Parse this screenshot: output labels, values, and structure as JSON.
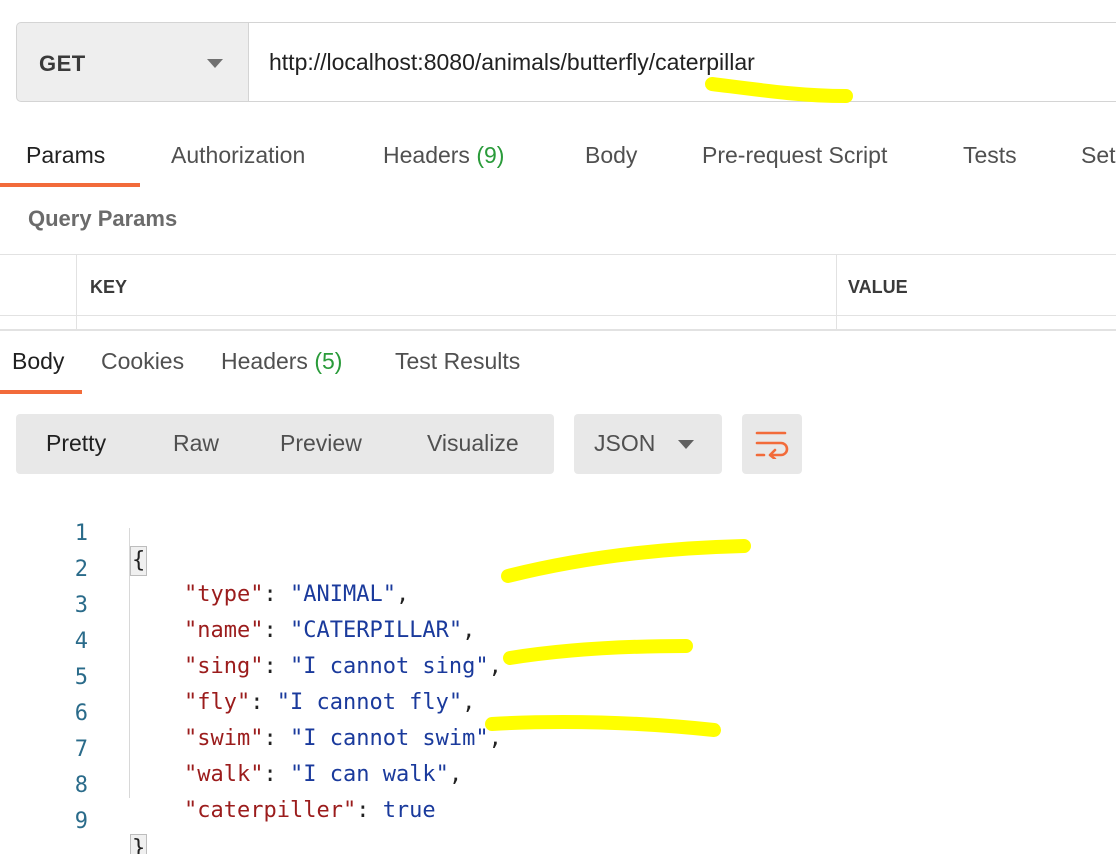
{
  "request": {
    "method": "GET",
    "url": "http://localhost:8080/animals/butterfly/caterpillar"
  },
  "request_tabs": [
    {
      "label": "Params",
      "count": ""
    },
    {
      "label": "Authorization",
      "count": ""
    },
    {
      "label": "Headers",
      "count": "(9)"
    },
    {
      "label": "Body",
      "count": ""
    },
    {
      "label": "Pre-request Script",
      "count": ""
    },
    {
      "label": "Tests",
      "count": ""
    },
    {
      "label": "Set",
      "count": ""
    }
  ],
  "query_params": {
    "title": "Query Params",
    "columns": [
      "KEY",
      "VALUE"
    ]
  },
  "response_tabs": [
    {
      "label": "Body",
      "count": ""
    },
    {
      "label": "Cookies",
      "count": ""
    },
    {
      "label": "Headers",
      "count": "(5)"
    },
    {
      "label": "Test Results",
      "count": ""
    }
  ],
  "view_modes": [
    "Pretty",
    "Raw",
    "Preview",
    "Visualize"
  ],
  "format": "JSON",
  "code_lines": [
    {
      "n": "1",
      "open": "{"
    },
    {
      "n": "2",
      "key": "\"type\"",
      "sep": ": ",
      "val": "\"ANIMAL\"",
      "end": ","
    },
    {
      "n": "3",
      "key": "\"name\"",
      "sep": ": ",
      "val": "\"CATERPILLAR\"",
      "end": ","
    },
    {
      "n": "4",
      "key": "\"sing\"",
      "sep": ": ",
      "val": "\"I cannot sing\"",
      "end": ","
    },
    {
      "n": "5",
      "key": "\"fly\"",
      "sep": ": ",
      "val": "\"I cannot fly\"",
      "end": ","
    },
    {
      "n": "6",
      "key": "\"swim\"",
      "sep": ": ",
      "val": "\"I cannot swim\"",
      "end": ","
    },
    {
      "n": "7",
      "key": "\"walk\"",
      "sep": ": ",
      "val": "\"I can walk\"",
      "end": ","
    },
    {
      "n": "8",
      "key": "\"caterpiller\"",
      "sep": ": ",
      "val": "true",
      "end": ""
    },
    {
      "n": "9",
      "close": "}"
    }
  ],
  "colors": {
    "accent": "#f26b3a",
    "count": "#2a9b3a",
    "json_key": "#9b1c1c",
    "json_value": "#1a3a9c",
    "highlight": "#ffff00"
  },
  "icons": {
    "method_dropdown": "chevron-down-icon",
    "format_dropdown": "chevron-down-icon",
    "wrap": "wrap-lines-icon"
  }
}
